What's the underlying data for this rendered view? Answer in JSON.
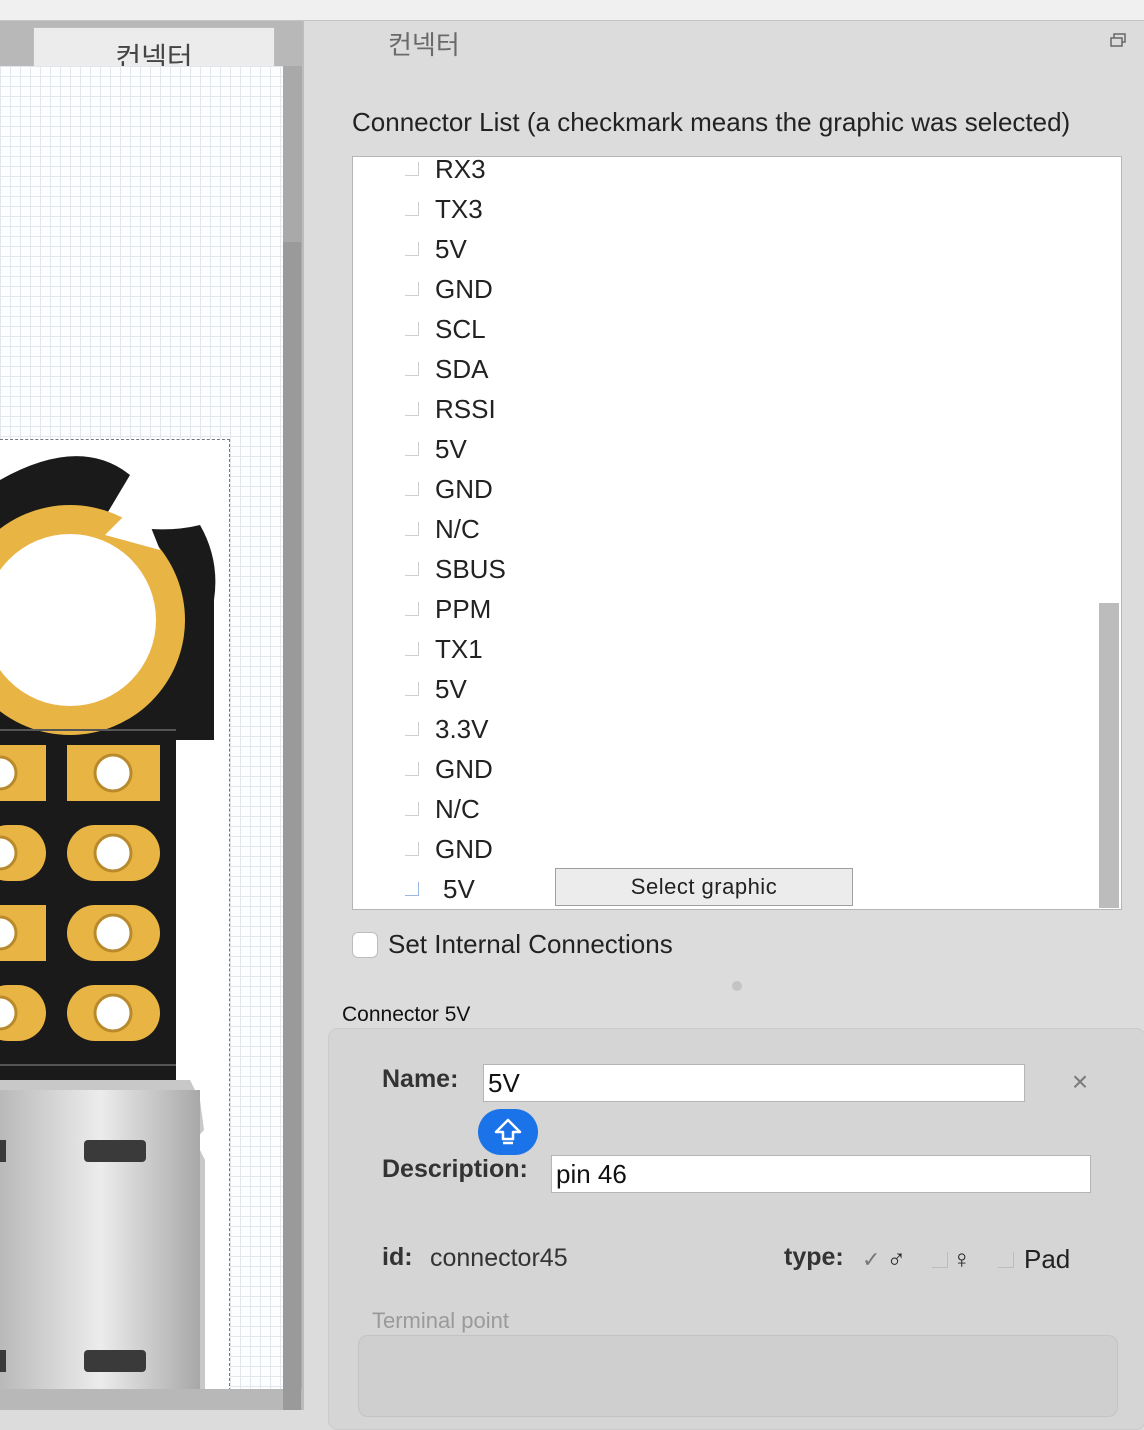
{
  "left_tab": {
    "label": "컨넥터"
  },
  "panel": {
    "title": "컨넥터"
  },
  "connector_list": {
    "heading": "Connector List (a checkmark means the graphic was selected)",
    "items": [
      {
        "label": "RX3"
      },
      {
        "label": "TX3"
      },
      {
        "label": "5V"
      },
      {
        "label": "GND"
      },
      {
        "label": "SCL"
      },
      {
        "label": "SDA"
      },
      {
        "label": "RSSI"
      },
      {
        "label": "5V"
      },
      {
        "label": "GND"
      },
      {
        "label": "N/C"
      },
      {
        "label": "SBUS"
      },
      {
        "label": "PPM"
      },
      {
        "label": "TX1"
      },
      {
        "label": "5V"
      },
      {
        "label": "3.3V"
      },
      {
        "label": "GND"
      },
      {
        "label": "N/C"
      },
      {
        "label": "GND"
      },
      {
        "label": "5V"
      }
    ],
    "select_graphic_label": "Select graphic"
  },
  "internal": {
    "label": "Set Internal Connections",
    "checked": false
  },
  "connector": {
    "title": "Connector 5V",
    "name_label": "Name:",
    "name_value": "5V",
    "description_label": "Description:",
    "description_value": "pin 46",
    "id_label": "id:",
    "id_value": "connector45",
    "type_label": "type:",
    "type_options": [
      {
        "glyph": "♂",
        "checked": true
      },
      {
        "glyph": "♀",
        "checked": false
      },
      {
        "glyph": "Pad",
        "checked": false
      }
    ],
    "terminal_label": "Terminal point"
  },
  "colors": {
    "accent": "#1a73e8",
    "pcb_black": "#1a1a1a",
    "pcb_gold": "#e8b443"
  }
}
